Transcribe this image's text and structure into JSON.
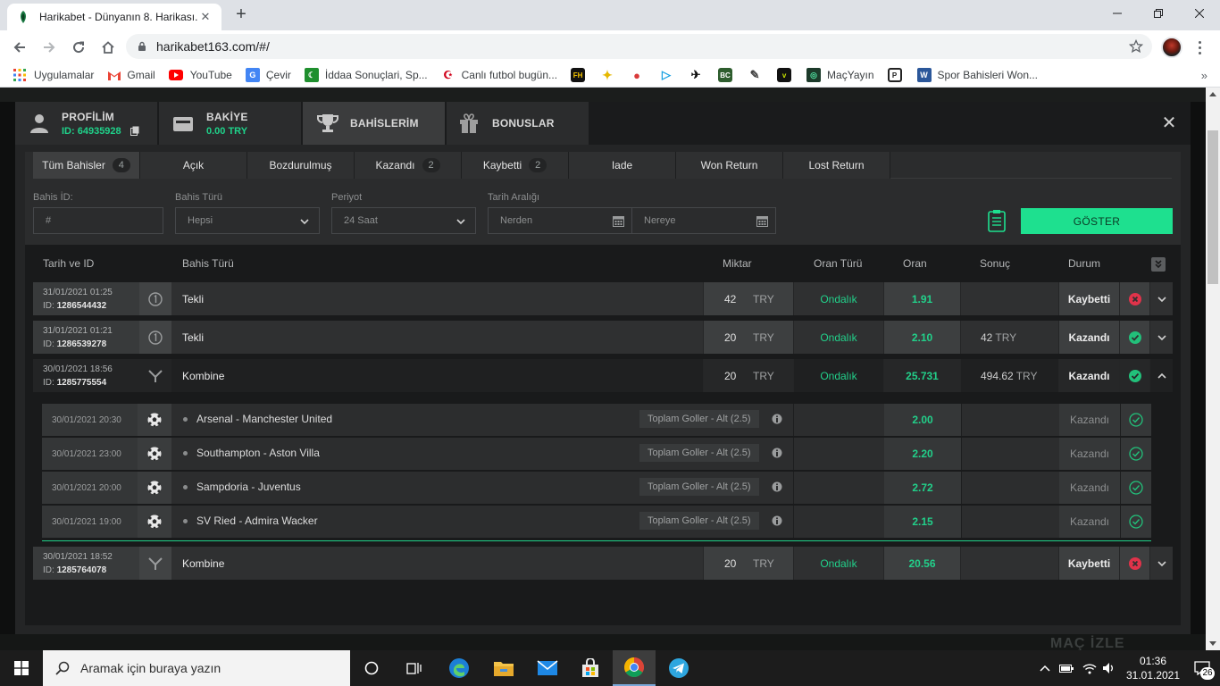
{
  "browser": {
    "tab_title": "Harikabet - Dünyanın 8. Harikası.",
    "url": "harikabet163.com/#/"
  },
  "bookmarks": {
    "apps_label": "Uygulamalar",
    "gmail": "Gmail",
    "youtube": "YouTube",
    "translate": "Çevir",
    "iddaa": "İddaa Sonuçlari, Sp...",
    "canli": "Canlı futbol bugün...",
    "macyayin": "MaçYayın",
    "spor": "Spor Bahisleri Won..."
  },
  "modal": {
    "header_tabs": {
      "profile_label": "PROFİLİM",
      "profile_id": "ID: 64935928",
      "balance_label": "BAKİYE",
      "balance_value": "0.00 TRY",
      "bets_label": "BAHİSLERİM",
      "bonus_label": "BONUSLAR"
    },
    "filter_tabs": [
      {
        "label": "Tüm Bahisler",
        "count": "4"
      },
      {
        "label": "Açık",
        "count": ""
      },
      {
        "label": "Bozdurulmuş",
        "count": ""
      },
      {
        "label": "Kazandı",
        "count": "2"
      },
      {
        "label": "Kaybetti",
        "count": "2"
      },
      {
        "label": "Iade",
        "count": ""
      },
      {
        "label": "Won Return",
        "count": ""
      },
      {
        "label": "Lost Return",
        "count": ""
      }
    ],
    "filters": {
      "bet_id_label": "Bahis İD:",
      "bet_id_placeholder": "#",
      "bet_type_label": "Bahis Türü",
      "bet_type_value": "Hepsi",
      "period_label": "Periyot",
      "period_value": "24 Saat",
      "date_range_label": "Tarih Aralığı",
      "date_from": "Nerden",
      "date_to": "Nereye",
      "show_button": "GÖSTER"
    },
    "table": {
      "headers": {
        "date_id": "Tarih ve ID",
        "bet_type": "Bahis Türü",
        "amount": "Miktar",
        "odds_type": "Oran Türü",
        "odds": "Oran",
        "result": "Sonuç",
        "status": "Durum"
      },
      "rows": [
        {
          "date": "31/01/2021 01:25",
          "id_prefix": "ID:",
          "id": "1286544432",
          "type": "Tekli",
          "amount": "42",
          "currency": "TRY",
          "odds_type": "Ondalık",
          "odds": "1.91",
          "result": "",
          "result_currency": "",
          "status": "Kaybetti"
        },
        {
          "date": "31/01/2021 01:21",
          "id_prefix": "ID:",
          "id": "1286539278",
          "type": "Tekli",
          "amount": "20",
          "currency": "TRY",
          "odds_type": "Ondalık",
          "odds": "2.10",
          "result": "42",
          "result_currency": "TRY",
          "status": "Kazandı"
        },
        {
          "date": "30/01/2021 18:56",
          "id_prefix": "ID:",
          "id": "1285775554",
          "type": "Kombine",
          "amount": "20",
          "currency": "TRY",
          "odds_type": "Ondalık",
          "odds": "25.731",
          "result": "494.62",
          "result_currency": "TRY",
          "status": "Kazandı"
        },
        {
          "date": "30/01/2021 18:52",
          "id_prefix": "ID:",
          "id": "1285764078",
          "type": "Kombine",
          "amount": "20",
          "currency": "TRY",
          "odds_type": "Ondalık",
          "odds": "20.56",
          "result": "",
          "result_currency": "",
          "status": "Kaybetti"
        }
      ],
      "events": [
        {
          "date": "30/01/2021 20:30",
          "match": "Arsenal - Manchester United",
          "market": "Toplam Goller - Alt (2.5)",
          "odds": "2.00",
          "status": "Kazandı"
        },
        {
          "date": "30/01/2021 23:00",
          "match": "Southampton - Aston Villa",
          "market": "Toplam Goller - Alt (2.5)",
          "odds": "2.20",
          "status": "Kazandı"
        },
        {
          "date": "30/01/2021 20:00",
          "match": "Sampdoria - Juventus",
          "market": "Toplam Goller - Alt (2.5)",
          "odds": "2.72",
          "status": "Kazandı"
        },
        {
          "date": "30/01/2021 19:00",
          "match": "SV Ried - Admira Wacker",
          "market": "Toplam Goller - Alt (2.5)",
          "odds": "2.15",
          "status": "Kazandı"
        }
      ]
    }
  },
  "background": {
    "promo_text": "MAÇ İZLE"
  },
  "taskbar": {
    "search_placeholder": "Aramak için buraya yazın",
    "time": "01:36",
    "date": "31.01.2021",
    "notification_count": "26"
  },
  "colors": {
    "accent": "#1ee08f",
    "win": "#22c07a",
    "loss": "#e0334a"
  }
}
